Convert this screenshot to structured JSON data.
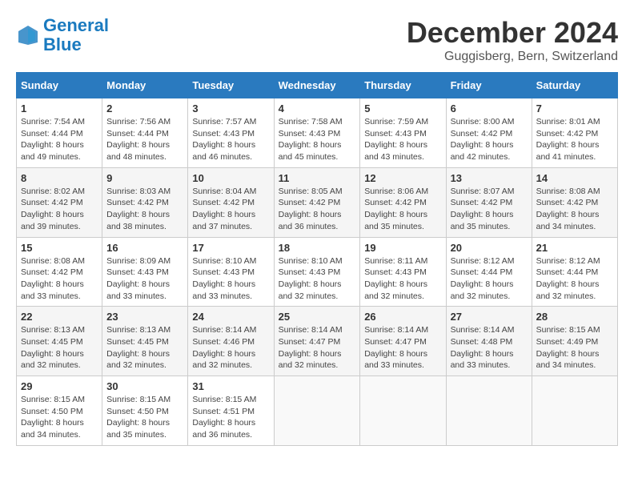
{
  "header": {
    "logo_line1": "General",
    "logo_line2": "Blue",
    "month_title": "December 2024",
    "location": "Guggisberg, Bern, Switzerland"
  },
  "weekdays": [
    "Sunday",
    "Monday",
    "Tuesday",
    "Wednesday",
    "Thursday",
    "Friday",
    "Saturday"
  ],
  "weeks": [
    [
      {
        "day": "1",
        "sunrise": "7:54 AM",
        "sunset": "4:44 PM",
        "daylight": "8 hours and 49 minutes."
      },
      {
        "day": "2",
        "sunrise": "7:56 AM",
        "sunset": "4:44 PM",
        "daylight": "8 hours and 48 minutes."
      },
      {
        "day": "3",
        "sunrise": "7:57 AM",
        "sunset": "4:43 PM",
        "daylight": "8 hours and 46 minutes."
      },
      {
        "day": "4",
        "sunrise": "7:58 AM",
        "sunset": "4:43 PM",
        "daylight": "8 hours and 45 minutes."
      },
      {
        "day": "5",
        "sunrise": "7:59 AM",
        "sunset": "4:43 PM",
        "daylight": "8 hours and 43 minutes."
      },
      {
        "day": "6",
        "sunrise": "8:00 AM",
        "sunset": "4:42 PM",
        "daylight": "8 hours and 42 minutes."
      },
      {
        "day": "7",
        "sunrise": "8:01 AM",
        "sunset": "4:42 PM",
        "daylight": "8 hours and 41 minutes."
      }
    ],
    [
      {
        "day": "8",
        "sunrise": "8:02 AM",
        "sunset": "4:42 PM",
        "daylight": "8 hours and 39 minutes."
      },
      {
        "day": "9",
        "sunrise": "8:03 AM",
        "sunset": "4:42 PM",
        "daylight": "8 hours and 38 minutes."
      },
      {
        "day": "10",
        "sunrise": "8:04 AM",
        "sunset": "4:42 PM",
        "daylight": "8 hours and 37 minutes."
      },
      {
        "day": "11",
        "sunrise": "8:05 AM",
        "sunset": "4:42 PM",
        "daylight": "8 hours and 36 minutes."
      },
      {
        "day": "12",
        "sunrise": "8:06 AM",
        "sunset": "4:42 PM",
        "daylight": "8 hours and 35 minutes."
      },
      {
        "day": "13",
        "sunrise": "8:07 AM",
        "sunset": "4:42 PM",
        "daylight": "8 hours and 35 minutes."
      },
      {
        "day": "14",
        "sunrise": "8:08 AM",
        "sunset": "4:42 PM",
        "daylight": "8 hours and 34 minutes."
      }
    ],
    [
      {
        "day": "15",
        "sunrise": "8:08 AM",
        "sunset": "4:42 PM",
        "daylight": "8 hours and 33 minutes."
      },
      {
        "day": "16",
        "sunrise": "8:09 AM",
        "sunset": "4:43 PM",
        "daylight": "8 hours and 33 minutes."
      },
      {
        "day": "17",
        "sunrise": "8:10 AM",
        "sunset": "4:43 PM",
        "daylight": "8 hours and 33 minutes."
      },
      {
        "day": "18",
        "sunrise": "8:10 AM",
        "sunset": "4:43 PM",
        "daylight": "8 hours and 32 minutes."
      },
      {
        "day": "19",
        "sunrise": "8:11 AM",
        "sunset": "4:43 PM",
        "daylight": "8 hours and 32 minutes."
      },
      {
        "day": "20",
        "sunrise": "8:12 AM",
        "sunset": "4:44 PM",
        "daylight": "8 hours and 32 minutes."
      },
      {
        "day": "21",
        "sunrise": "8:12 AM",
        "sunset": "4:44 PM",
        "daylight": "8 hours and 32 minutes."
      }
    ],
    [
      {
        "day": "22",
        "sunrise": "8:13 AM",
        "sunset": "4:45 PM",
        "daylight": "8 hours and 32 minutes."
      },
      {
        "day": "23",
        "sunrise": "8:13 AM",
        "sunset": "4:45 PM",
        "daylight": "8 hours and 32 minutes."
      },
      {
        "day": "24",
        "sunrise": "8:14 AM",
        "sunset": "4:46 PM",
        "daylight": "8 hours and 32 minutes."
      },
      {
        "day": "25",
        "sunrise": "8:14 AM",
        "sunset": "4:47 PM",
        "daylight": "8 hours and 32 minutes."
      },
      {
        "day": "26",
        "sunrise": "8:14 AM",
        "sunset": "4:47 PM",
        "daylight": "8 hours and 33 minutes."
      },
      {
        "day": "27",
        "sunrise": "8:14 AM",
        "sunset": "4:48 PM",
        "daylight": "8 hours and 33 minutes."
      },
      {
        "day": "28",
        "sunrise": "8:15 AM",
        "sunset": "4:49 PM",
        "daylight": "8 hours and 34 minutes."
      }
    ],
    [
      {
        "day": "29",
        "sunrise": "8:15 AM",
        "sunset": "4:50 PM",
        "daylight": "8 hours and 34 minutes."
      },
      {
        "day": "30",
        "sunrise": "8:15 AM",
        "sunset": "4:50 PM",
        "daylight": "8 hours and 35 minutes."
      },
      {
        "day": "31",
        "sunrise": "8:15 AM",
        "sunset": "4:51 PM",
        "daylight": "8 hours and 36 minutes."
      },
      null,
      null,
      null,
      null
    ]
  ]
}
